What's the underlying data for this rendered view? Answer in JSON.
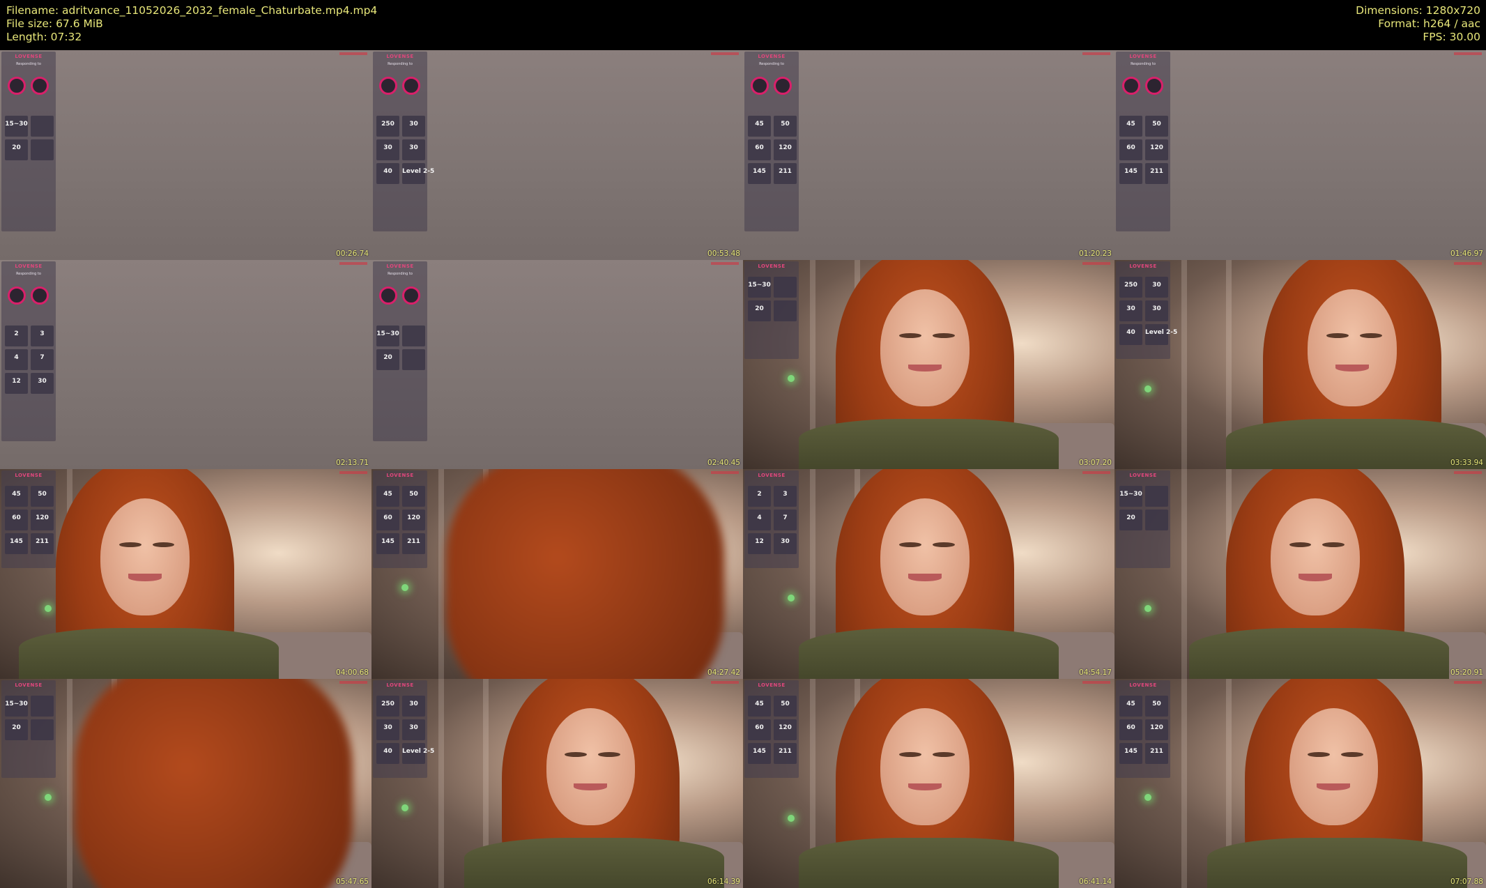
{
  "header": {
    "filename": "Filename: adritvance_11052026_2032_female_Chaturbate.mp4.mp4",
    "filesize": "File size: 67.6 MiB",
    "length": "Length: 07:32",
    "dimensions": "Dimensions: 1280x720",
    "format": "Format: h264 / aac",
    "fps": "FPS: 30.00"
  },
  "overlay": {
    "brand": "LOVENSE",
    "responding": "Responding to"
  },
  "colors": {
    "header_text": "#e8e77a",
    "lovense_pink": "#e0477c",
    "ring": "#d8206a"
  },
  "frames": [
    {
      "timestamp": "00:26.74",
      "scene": "empty",
      "tiles": [
        "15~30",
        "",
        "20",
        ""
      ]
    },
    {
      "timestamp": "00:53.48",
      "scene": "empty",
      "tiles": [
        "250",
        "30",
        "30",
        "30",
        "40",
        "Level 2-5"
      ]
    },
    {
      "timestamp": "01:20.23",
      "scene": "empty",
      "tiles": [
        "45",
        "50",
        "60",
        "120",
        "145",
        "211"
      ]
    },
    {
      "timestamp": "01:46.97",
      "scene": "empty",
      "tiles": [
        "45",
        "50",
        "60",
        "120",
        "145",
        "211"
      ]
    },
    {
      "timestamp": "02:13.71",
      "scene": "empty",
      "tiles": [
        "2",
        "3",
        "4",
        "7",
        "12",
        "30"
      ]
    },
    {
      "timestamp": "02:40.45",
      "scene": "empty",
      "tiles": [
        "15~30",
        "",
        "20",
        ""
      ]
    },
    {
      "timestamp": "03:07.20",
      "scene": "face",
      "tiles": [
        "15~30",
        "",
        "20",
        ""
      ]
    },
    {
      "timestamp": "03:33.94",
      "scene": "face",
      "tiles": [
        "250",
        "30",
        "30",
        "30",
        "40",
        "Level 2-5"
      ]
    },
    {
      "timestamp": "04:00.68",
      "scene": "face",
      "tiles": [
        "45",
        "50",
        "60",
        "120",
        "145",
        "211"
      ]
    },
    {
      "timestamp": "04:27.42",
      "scene": "hair",
      "tiles": [
        "45",
        "50",
        "60",
        "120",
        "145",
        "211"
      ]
    },
    {
      "timestamp": "04:54.17",
      "scene": "face",
      "tiles": [
        "2",
        "3",
        "4",
        "7",
        "12",
        "30"
      ]
    },
    {
      "timestamp": "05:20.91",
      "scene": "face",
      "tiles": [
        "15~30",
        "",
        "20",
        ""
      ]
    },
    {
      "timestamp": "05:47.65",
      "scene": "hair",
      "tiles": [
        "15~30",
        "",
        "20",
        ""
      ]
    },
    {
      "timestamp": "06:14.39",
      "scene": "face",
      "tiles": [
        "250",
        "30",
        "30",
        "30",
        "40",
        "Level 2-5"
      ]
    },
    {
      "timestamp": "06:41.14",
      "scene": "face",
      "tiles": [
        "45",
        "50",
        "60",
        "120",
        "145",
        "211"
      ]
    },
    {
      "timestamp": "07:07.88",
      "scene": "face",
      "tiles": [
        "45",
        "50",
        "60",
        "120",
        "145",
        "211"
      ]
    }
  ]
}
